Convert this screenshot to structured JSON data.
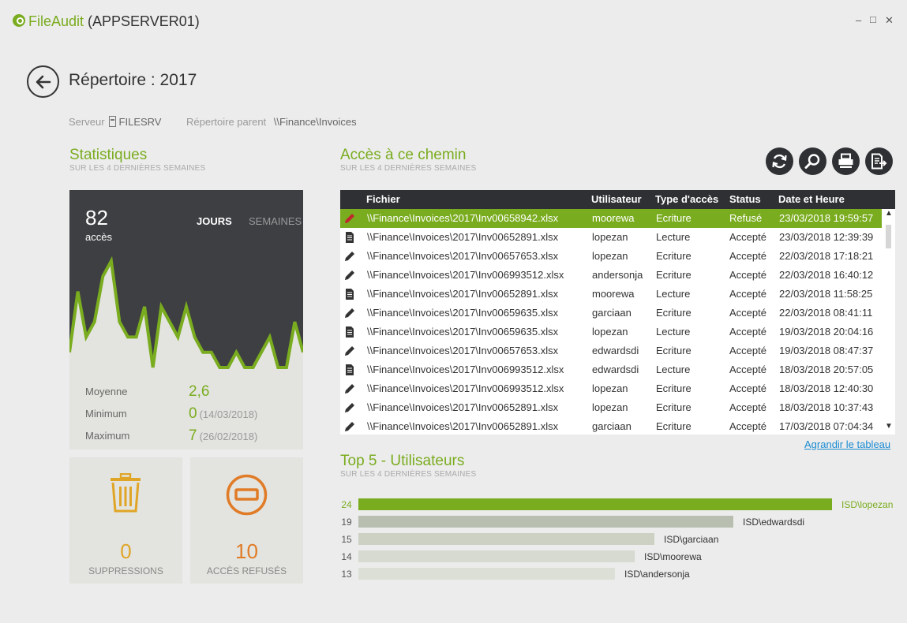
{
  "window": {
    "app_name": "FileAudit",
    "host": "(APPSERVER01)",
    "minimize": "–",
    "maximize": "□",
    "close": "✕"
  },
  "page": {
    "title": "Répertoire : 2017",
    "server_label": "Serveur",
    "server_value": "FILESRV",
    "parent_label": "Répertoire parent",
    "parent_value": "\\\\Finance\\Invoices"
  },
  "stats": {
    "title": "Statistiques",
    "subtitle": "SUR LES 4 DERNIÈRES SEMAINES",
    "count": "82",
    "count_label": "accès",
    "tab_days": "JOURS",
    "tab_weeks": "SEMAINES",
    "daily_access": [
      1,
      5,
      2,
      3,
      6,
      7,
      3,
      2,
      2,
      4,
      0,
      4,
      3,
      2,
      4,
      2,
      1,
      1,
      0,
      0,
      1,
      0,
      0,
      1,
      2,
      0,
      0,
      3,
      1
    ],
    "average_label": "Moyenne",
    "average_value": "2,6",
    "min_label": "Minimum",
    "min_value": "0",
    "min_date": "(14/03/2018)",
    "max_label": "Maximum",
    "max_value": "7",
    "max_date": "(26/02/2018)"
  },
  "tiles": {
    "deletions_value": "0",
    "deletions_label": "SUPPRESSIONS",
    "denied_value": "10",
    "denied_label": "ACCÈS REFUSÉS"
  },
  "access": {
    "title": "Accès à ce chemin",
    "subtitle": "SUR LES 4 DERNIÈRES SEMAINES",
    "buttons": [
      "refresh-icon",
      "search-icon",
      "print-icon",
      "export-icon"
    ],
    "columns": [
      "Fichier",
      "Utilisateur",
      "Type d'accès",
      "Status",
      "Date et Heure"
    ],
    "rows": [
      {
        "icon": "pencil",
        "file": "\\\\Finance\\Invoices\\2017\\Inv00658942.xlsx",
        "user": "moorewa",
        "type": "Ecriture",
        "status": "Refusé",
        "date": "23/03/2018 19:59:57"
      },
      {
        "icon": "doc",
        "file": "\\\\Finance\\Invoices\\2017\\Inv00652891.xlsx",
        "user": "lopezan",
        "type": "Lecture",
        "status": "Accepté",
        "date": "23/03/2018 12:39:39"
      },
      {
        "icon": "pencil",
        "file": "\\\\Finance\\Invoices\\2017\\Inv00657653.xlsx",
        "user": "lopezan",
        "type": "Ecriture",
        "status": "Accepté",
        "date": "22/03/2018 17:18:21"
      },
      {
        "icon": "pencil",
        "file": "\\\\Finance\\Invoices\\2017\\Inv006993512.xlsx",
        "user": "andersonja",
        "type": "Ecriture",
        "status": "Accepté",
        "date": "22/03/2018 16:40:12"
      },
      {
        "icon": "doc",
        "file": "\\\\Finance\\Invoices\\2017\\Inv00652891.xlsx",
        "user": "moorewa",
        "type": "Lecture",
        "status": "Accepté",
        "date": "22/03/2018 11:58:25"
      },
      {
        "icon": "pencil",
        "file": "\\\\Finance\\Invoices\\2017\\Inv00659635.xlsx",
        "user": "garciaan",
        "type": "Ecriture",
        "status": "Accepté",
        "date": "22/03/2018 08:41:11"
      },
      {
        "icon": "doc",
        "file": "\\\\Finance\\Invoices\\2017\\Inv00659635.xlsx",
        "user": "lopezan",
        "type": "Lecture",
        "status": "Accepté",
        "date": "19/03/2018 20:04:16"
      },
      {
        "icon": "pencil",
        "file": "\\\\Finance\\Invoices\\2017\\Inv00657653.xlsx",
        "user": "edwardsdi",
        "type": "Ecriture",
        "status": "Accepté",
        "date": "19/03/2018 08:47:37"
      },
      {
        "icon": "doc",
        "file": "\\\\Finance\\Invoices\\2017\\Inv006993512.xlsx",
        "user": "edwardsdi",
        "type": "Lecture",
        "status": "Accepté",
        "date": "18/03/2018 20:57:05"
      },
      {
        "icon": "pencil",
        "file": "\\\\Finance\\Invoices\\2017\\Inv006993512.xlsx",
        "user": "lopezan",
        "type": "Ecriture",
        "status": "Accepté",
        "date": "18/03/2018 12:40:30"
      },
      {
        "icon": "pencil",
        "file": "\\\\Finance\\Invoices\\2017\\Inv00652891.xlsx",
        "user": "lopezan",
        "type": "Ecriture",
        "status": "Accepté",
        "date": "18/03/2018 10:37:43"
      },
      {
        "icon": "pencil",
        "file": "\\\\Finance\\Invoices\\2017\\Inv00652891.xlsx",
        "user": "garciaan",
        "type": "Ecriture",
        "status": "Accepté",
        "date": "17/03/2018 07:04:34"
      }
    ],
    "expand_link": "Agrandir le tableau"
  },
  "top_users": {
    "title": "Top 5 - Utilisateurs",
    "subtitle": "SUR LES 4 DERNIÈRES SEMAINES",
    "items": [
      {
        "count": 24,
        "label": "ISD\\lopezan"
      },
      {
        "count": 19,
        "label": "ISD\\edwardsdi"
      },
      {
        "count": 15,
        "label": "ISD\\garciaan"
      },
      {
        "count": 14,
        "label": "ISD\\moorewa"
      },
      {
        "count": 13,
        "label": "ISD\\andersonja"
      }
    ]
  },
  "colors": {
    "accent": "#7aac1f",
    "dark": "#2e3033",
    "deletions": "#e0a526",
    "denied": "#e07b27",
    "bar_2": "#b9bfb0",
    "bar_3": "#ccd1c4",
    "bar_4": "#d6dad0",
    "bar_5": "#dcdfd6"
  }
}
